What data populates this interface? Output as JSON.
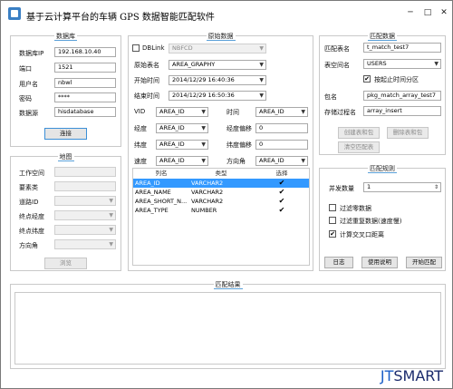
{
  "window": {
    "title": "基于云计算平台的车辆 GPS 数据智能匹配软件",
    "minimize": "─",
    "maximize": "□",
    "close": "✕"
  },
  "db_panel": {
    "title": "数据库",
    "fields": [
      {
        "label": "数据库IP",
        "value": "192.168.10.40"
      },
      {
        "label": "端口",
        "value": "1521"
      },
      {
        "label": "用户名",
        "value": "nbwl"
      },
      {
        "label": "密码",
        "value": "****"
      },
      {
        "label": "数据源",
        "value": "hisdatabase"
      }
    ],
    "connect_label": "连接"
  },
  "map_panel": {
    "title": "地图",
    "fields": [
      {
        "label": "工作空间",
        "kind": "input",
        "value": ""
      },
      {
        "label": "要素类",
        "kind": "input",
        "value": ""
      },
      {
        "label": "道路ID",
        "kind": "select",
        "value": ""
      },
      {
        "label": "终点经度",
        "kind": "select",
        "value": ""
      },
      {
        "label": "终点纬度",
        "kind": "select",
        "value": ""
      },
      {
        "label": "方向角",
        "kind": "select",
        "value": ""
      }
    ],
    "browse_label": "浏览"
  },
  "source_panel": {
    "title": "原始数据",
    "dblink_label": "DBLink",
    "dblink_value": "NBFCD",
    "table_label": "原始表名",
    "table_value": "AREA_GRAPHY",
    "start_label": "开始时间",
    "start_value": "2014/12/29 16:40:36",
    "end_label": "结束时间",
    "end_value": "2014/12/29 16:50:36",
    "mappings": [
      {
        "label": "VID",
        "value": "AREA_ID",
        "label2": "时间",
        "value2": "AREA_ID",
        "kind2": "select"
      },
      {
        "label": "经度",
        "value": "AREA_ID",
        "label2": "经度偏移",
        "value2": "0",
        "kind2": "input"
      },
      {
        "label": "纬度",
        "value": "AREA_ID",
        "label2": "纬度偏移",
        "value2": "0",
        "kind2": "input"
      },
      {
        "label": "速度",
        "value": "AREA_ID",
        "label2": "方向角",
        "value2": "AREA_ID",
        "kind2": "select"
      }
    ],
    "grid": {
      "headers": [
        "列名",
        "类型",
        "选择"
      ],
      "rows": [
        {
          "name": "AREA_ID",
          "type": "VARCHAR2",
          "checked": "✔"
        },
        {
          "name": "AREA_NAME",
          "type": "VARCHAR2",
          "checked": "✔"
        },
        {
          "name": "AREA_SHORT_N...",
          "type": "VARCHAR2",
          "checked": "✔"
        },
        {
          "name": "AREA_TYPE",
          "type": "NUMBER",
          "checked": "✔"
        }
      ]
    }
  },
  "match_panel": {
    "title": "匹配数据",
    "table_label": "匹配表名",
    "table_value": "t_match_test7",
    "space_label": "表空间名",
    "space_value": "USERS",
    "partition_label": "按起止时间分区",
    "package_label": "包名",
    "package_value": "pkg_match_array_test7",
    "proc_label": "存储过程名",
    "proc_value": "array_insert",
    "create_label": "创建表和包",
    "delete_label": "删除表和包",
    "clear_label": "清空匹配表"
  },
  "rules_panel": {
    "title": "匹配规则",
    "concurrency_label": "并发数量",
    "concurrency_value": "1",
    "opt1": "过滤零数据",
    "opt2": "过滤重复数据(速度慢)",
    "opt3": "计算交叉口距离",
    "log_label": "日志",
    "help_label": "使用说明",
    "start_label": "开始匹配"
  },
  "result_panel": {
    "title": "匹配结果"
  },
  "watermark": {
    "a": "JT",
    "b": "SMART"
  }
}
